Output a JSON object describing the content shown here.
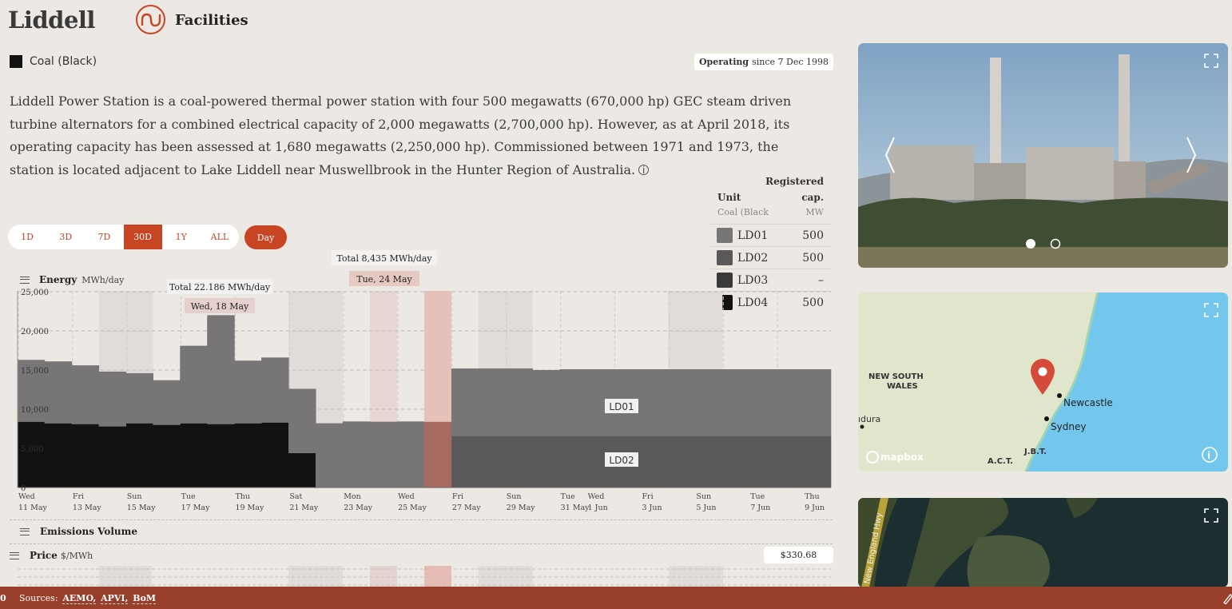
{
  "header": {
    "title": "Liddell",
    "facilities_label": "Facilities"
  },
  "facility": {
    "fuel_type": "Coal (Black)",
    "fuel_color": "#111111",
    "status_bold": "Operating",
    "status_since": "since 7 Dec 1998",
    "description": "Liddell Power Station is a coal-powered thermal power station with four 500 megawatts (670,000 hp) GEC steam driven turbine alternators for a combined electrical capacity of 2,000 megawatts (2,700,000 hp). However, as at April 2018, its operating capacity has been assessed at 1,680 megawatts (2,250,000 hp). Commissioned between 1971 and 1973, the station is located adjacent to Lake Liddell near Muswellbrook in the Hunter Region of Australia."
  },
  "range_buttons": [
    {
      "label": "1D",
      "active": false
    },
    {
      "label": "3D",
      "active": false
    },
    {
      "label": "7D",
      "active": false
    },
    {
      "label": "30D",
      "active": true
    },
    {
      "label": "1Y",
      "active": false
    },
    {
      "label": "ALL",
      "active": false
    }
  ],
  "interval_button": "Day",
  "units_table": {
    "header_registered": "Registered",
    "header_unit": "Unit",
    "header_cap": "cap.",
    "sub_fuel": "Coal (Black",
    "sub_unit": "MW",
    "rows": [
      {
        "name": "LD01",
        "cap": "500",
        "color": "#777575"
      },
      {
        "name": "LD02",
        "cap": "500",
        "color": "#5a5858"
      },
      {
        "name": "LD03",
        "cap": "–",
        "color": "#3a3838"
      },
      {
        "name": "LD04",
        "cap": "500",
        "color": "#121212"
      }
    ]
  },
  "energy_panel": {
    "title": "Energy",
    "unit": "MWh/day",
    "tooltip_hover": {
      "total_label": "Total",
      "total_value": "22.186 MWh/day",
      "date": "Wed, 18 May"
    },
    "tooltip_selected": {
      "total_label": "Total",
      "total_value": "8,435 MWh/day",
      "date": "Tue, 24 May"
    },
    "series_labels": [
      "LD01",
      "LD02"
    ]
  },
  "chart_data": {
    "type": "area",
    "stacked": true,
    "ylabel": "MWh/day",
    "ylim": [
      0,
      25000
    ],
    "yticks": [
      "25,000",
      "20,000",
      "15,000",
      "10,000",
      "5,000",
      "0"
    ],
    "x": [
      "11 May",
      "12 May",
      "13 May",
      "14 May",
      "15 May",
      "16 May",
      "17 May",
      "18 May",
      "19 May",
      "20 May",
      "21 May",
      "22 May",
      "23 May",
      "24 May",
      "25 May",
      "26 May",
      "27 May",
      "28 May",
      "29 May",
      "30 May",
      "31 May",
      "1 Jun",
      "2 Jun",
      "3 Jun",
      "4 Jun",
      "5 Jun",
      "6 Jun",
      "7 Jun",
      "8 Jun",
      "9 Jun"
    ],
    "x_tick_labels": [
      {
        "day": "Wed",
        "date": "11 May"
      },
      {
        "day": "Fri",
        "date": "13 May"
      },
      {
        "day": "Sun",
        "date": "15 May"
      },
      {
        "day": "Tue",
        "date": "17 May"
      },
      {
        "day": "Thu",
        "date": "19 May"
      },
      {
        "day": "Sat",
        "date": "21 May"
      },
      {
        "day": "Mon",
        "date": "23 May"
      },
      {
        "day": "Wed",
        "date": "25 May"
      },
      {
        "day": "Fri",
        "date": "27 May"
      },
      {
        "day": "Sun",
        "date": "29 May"
      },
      {
        "day": "Tue",
        "date": "31 May"
      },
      {
        "day": "Wed",
        "date": "1 Jun"
      },
      {
        "day": "Fri",
        "date": "3 Jun"
      },
      {
        "day": "Sun",
        "date": "5 Jun"
      },
      {
        "day": "Tue",
        "date": "7 Jun"
      },
      {
        "day": "Thu",
        "date": "9 Jun"
      }
    ],
    "series": [
      {
        "name": "LD04",
        "color": "#121212",
        "values": [
          8400,
          8200,
          8100,
          7800,
          8200,
          8000,
          8200,
          8100,
          8200,
          8300,
          4400,
          0,
          0,
          0,
          0,
          0,
          0,
          0,
          0,
          0,
          0,
          0,
          0,
          0,
          0,
          0,
          0,
          0,
          0,
          0
        ]
      },
      {
        "name": "LD03",
        "color": "#3a3838",
        "values": [
          0,
          0,
          0,
          0,
          0,
          0,
          0,
          0,
          0,
          0,
          0,
          0,
          0,
          0,
          0,
          0,
          0,
          0,
          0,
          0,
          0,
          0,
          0,
          0,
          0,
          0,
          0,
          0,
          0,
          0
        ]
      },
      {
        "name": "LD02",
        "color": "#5a5858",
        "values": [
          0,
          0,
          0,
          0,
          0,
          0,
          0,
          0,
          0,
          0,
          0,
          0,
          0,
          0,
          0,
          0,
          6600,
          6600,
          6600,
          6600,
          6600,
          6600,
          6600,
          6600,
          6600,
          6600,
          6600,
          6600,
          6600,
          6600
        ]
      },
      {
        "name": "LD01",
        "color": "#777575",
        "values": [
          7900,
          7900,
          7500,
          7000,
          6400,
          5700,
          9900,
          13900,
          8000,
          8300,
          8200,
          8200,
          8435,
          8400,
          8435,
          8400,
          8600,
          8600,
          8600,
          8400,
          8500,
          8500,
          8500,
          8500,
          8500,
          8500,
          8500,
          8500,
          8500,
          8500
        ]
      }
    ],
    "weekend_bands": [
      "14 May",
      "15 May",
      "21 May",
      "22 May",
      "28 May",
      "29 May",
      "4 Jun",
      "5 Jun"
    ],
    "highlight_hover": "24 May",
    "highlight_selected": "26 May"
  },
  "emissions_panel": {
    "title": "Emissions Volume"
  },
  "price_panel": {
    "title": "Price",
    "unit": "$/MWh",
    "value": "$330.68"
  },
  "footer": {
    "left_fragment": "0",
    "sources_label": "Sources:",
    "sources": [
      "AEMO,",
      "APVI,",
      "BoM"
    ]
  },
  "map": {
    "region_label_line1": "NEW SOUTH",
    "region_label_line2": "WALES",
    "city1": "Newcastle",
    "city2": "Sydney",
    "act": "A.C.T.",
    "jbt": "J.B.T.",
    "west_fragment": "ıdura",
    "attribution": "mapbox"
  },
  "satellite": {
    "road_label": "New England Hwy"
  }
}
